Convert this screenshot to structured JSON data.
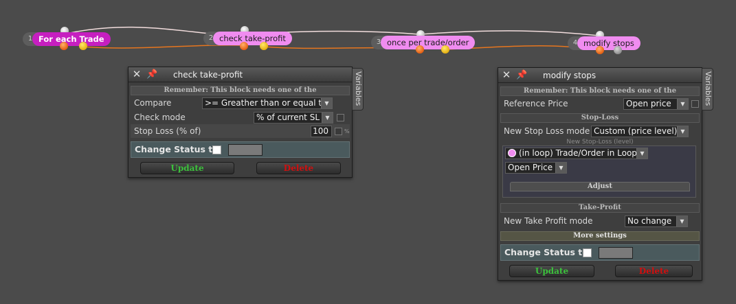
{
  "nodes": [
    {
      "num": "1",
      "label": "For each Trade",
      "style": "magenta"
    },
    {
      "num": "2",
      "label": "check take-profit",
      "style": "pink"
    },
    {
      "num": "3",
      "label": "once per trade/order",
      "style": "pink"
    },
    {
      "num": "4",
      "label": "modify stops",
      "style": "pink"
    }
  ],
  "panel1": {
    "title": "check take-profit",
    "close_icon": "close-icon",
    "pin_icon": "pin-icon",
    "variables_tab": "Variables",
    "remember": "Remember: This block needs one of the",
    "compare_label": "Compare",
    "compare_value": ">= Greather than or equal to",
    "check_mode_label": "Check mode",
    "check_mode_value": "% of current SL",
    "stop_loss_label": "Stop Loss (% of)",
    "stop_loss_value": "100",
    "pct_symbol": "%",
    "status_label": "Change Status to",
    "update_label": "Update",
    "delete_label": "Delete"
  },
  "panel2": {
    "title": "modify stops",
    "variables_tab": "Variables",
    "remember": "Remember: This block needs one of the",
    "ref_price_label": "Reference Price",
    "ref_price_value": "Open price",
    "stoploss_section": "Stop-Loss",
    "new_sl_mode_label": "New Stop Loss mode",
    "new_sl_mode_value": "Custom (price level)",
    "new_sl_level_caption": "New Stop-Loss (level)",
    "loop_value": "(in loop) Trade/Order in Loop",
    "price_type_value": "Open Price",
    "adjust_label": "Adjust",
    "takeprofit_section": "Take-Profit",
    "new_tp_mode_label": "New Take Profit mode",
    "new_tp_mode_value": "No change",
    "more_settings": "More settings",
    "status_label": "Change Status to",
    "update_label": "Update",
    "delete_label": "Delete"
  },
  "colors": {
    "background": "#4b4b4b",
    "node_magenta": "#c61fc0",
    "node_pink": "#f08cf0",
    "wire_orange": "#e8761e",
    "update_green": "#3cc13c",
    "delete_red": "#d10f0f"
  }
}
